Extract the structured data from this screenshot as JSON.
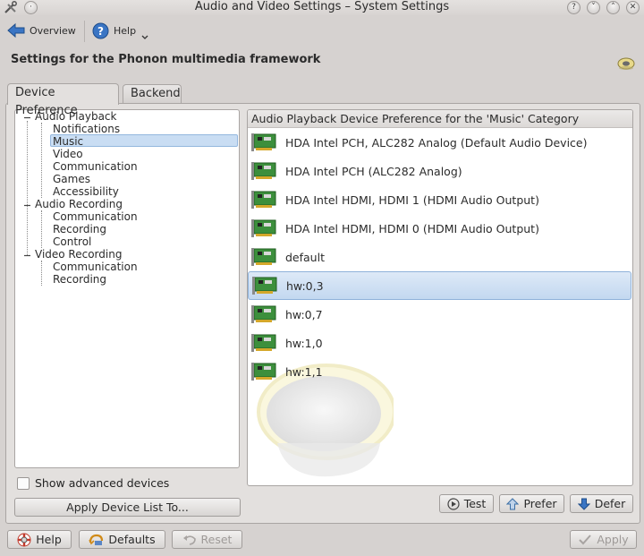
{
  "window": {
    "title": "Audio and Video Settings – System Settings"
  },
  "toolbar": {
    "overview_label": "Overview",
    "help_label": "Help"
  },
  "page": {
    "heading": "Settings for the Phonon multimedia framework"
  },
  "tabs": [
    {
      "label": "Device Preference",
      "active": true
    },
    {
      "label": "Backend",
      "active": false
    }
  ],
  "tree": {
    "groups": [
      {
        "label": "Audio Playback",
        "children": [
          "Notifications",
          "Music",
          "Video",
          "Communication",
          "Games",
          "Accessibility"
        ]
      },
      {
        "label": "Audio Recording",
        "children": [
          "Communication",
          "Recording",
          "Control"
        ]
      },
      {
        "label": "Video Recording",
        "children": [
          "Communication",
          "Recording"
        ]
      }
    ],
    "selected": "Music"
  },
  "device_list": {
    "header": "Audio Playback Device Preference for the 'Music' Category",
    "items": [
      "HDA Intel PCH, ALC282 Analog (Default Audio Device)",
      "HDA Intel PCH (ALC282 Analog)",
      "HDA Intel HDMI, HDMI 1 (HDMI Audio Output)",
      "HDA Intel HDMI, HDMI 0 (HDMI Audio Output)",
      "default",
      "hw:0,3",
      "hw:0,7",
      "hw:1,0",
      "hw:1,1"
    ],
    "selected": "hw:0,3"
  },
  "options": {
    "show_advanced_label": "Show advanced devices",
    "show_advanced_checked": false,
    "apply_list_label": "Apply Device List To..."
  },
  "actions": {
    "test": "Test",
    "prefer": "Prefer",
    "defer": "Defer"
  },
  "bottom": {
    "help": "Help",
    "defaults": "Defaults",
    "reset": "Reset",
    "apply": "Apply"
  },
  "colors": {
    "selection": "#c9ddf3",
    "background": "#d6d2d0",
    "accent": "#3a75c4"
  }
}
